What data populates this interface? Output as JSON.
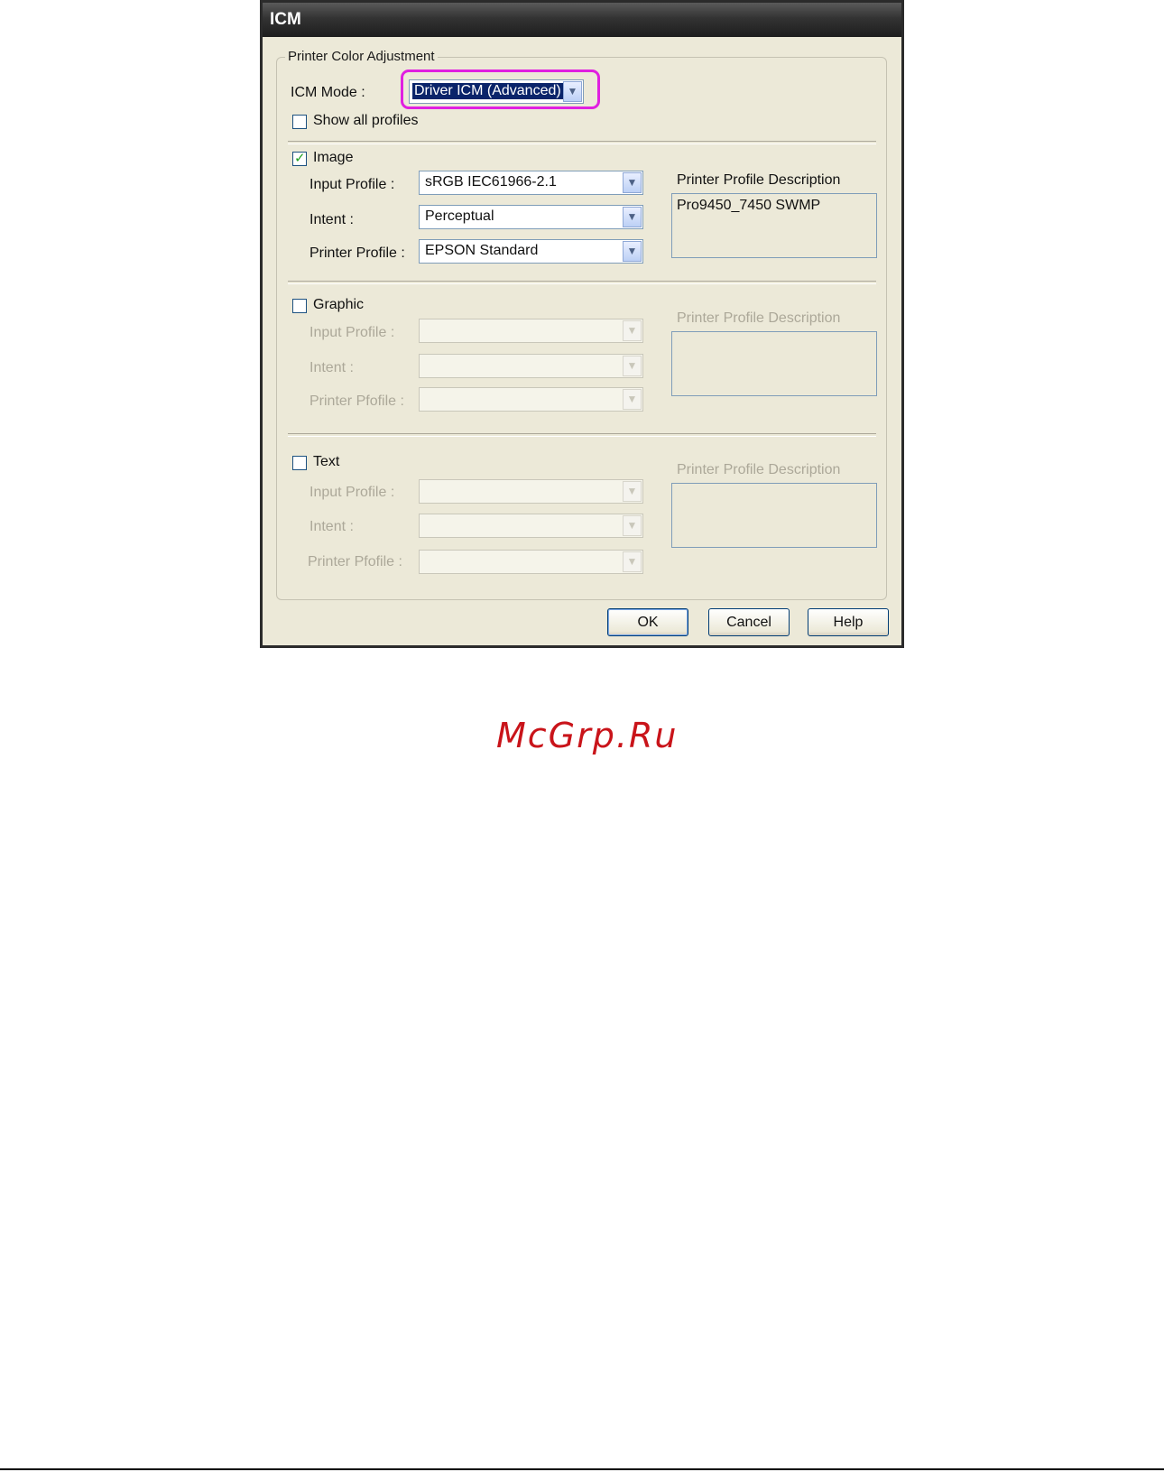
{
  "dialog": {
    "title": "ICM",
    "group_title": "Printer Color Adjustment",
    "icm_mode": {
      "label": "ICM Mode :",
      "value": "Driver ICM (Advanced)"
    },
    "show_all_profiles": {
      "label": "Show all profiles",
      "checked": false
    },
    "sections": {
      "image": {
        "label": "Image",
        "checked": true,
        "input_profile_label": "Input Profile :",
        "input_profile_value": "sRGB IEC61966-2.1",
        "intent_label": "Intent :",
        "intent_value": "Perceptual",
        "printer_profile_label": "Printer Profile :",
        "printer_profile_value": "EPSON Standard",
        "desc_label": "Printer Profile Description",
        "desc_value": "Pro9450_7450 SWMP"
      },
      "graphic": {
        "label": "Graphic",
        "checked": false,
        "input_profile_label": "Input Profile :",
        "intent_label": "Intent :",
        "printer_profile_label": "Printer Pfofile :",
        "desc_label": "Printer Profile Description"
      },
      "text": {
        "label": "Text",
        "checked": false,
        "input_profile_label": "Input Profile :",
        "intent_label": "Intent :",
        "printer_profile_label": "Printer Pfofile :",
        "desc_label": "Printer Profile Description"
      }
    },
    "buttons": {
      "ok": "OK",
      "cancel": "Cancel",
      "help": "Help"
    }
  },
  "watermark": "McGrp.Ru",
  "colors": {
    "highlight": "#e020e0",
    "watermark": "#c9141a",
    "titlebar": "#333333"
  }
}
